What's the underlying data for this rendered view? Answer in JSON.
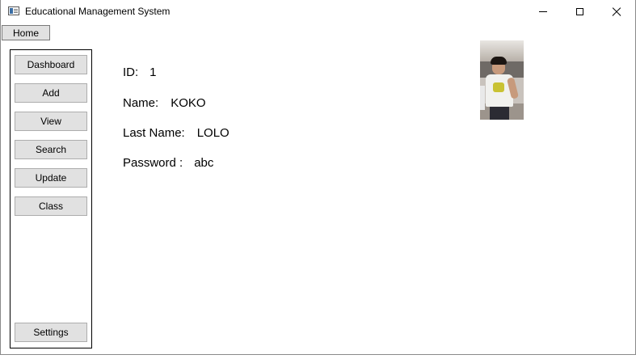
{
  "window": {
    "title": "Educational Management System"
  },
  "menu": {
    "home_label": "Home"
  },
  "sidebar": {
    "items": [
      {
        "label": "Dashboard"
      },
      {
        "label": "Add"
      },
      {
        "label": "View"
      },
      {
        "label": "Search"
      },
      {
        "label": "Update"
      },
      {
        "label": "Class"
      }
    ],
    "settings_label": "Settings"
  },
  "profile": {
    "id_label": "ID:",
    "id_value": "1",
    "name_label": "Name:",
    "name_value": "KOKO",
    "last_name_label": "Last Name:",
    "last_name_value": "LOLO",
    "password_label": "Password :",
    "password_value": "abc"
  },
  "colors": {
    "button_face": "#e1e1e1",
    "button_border": "#adadad",
    "window_bg": "#ffffff"
  }
}
